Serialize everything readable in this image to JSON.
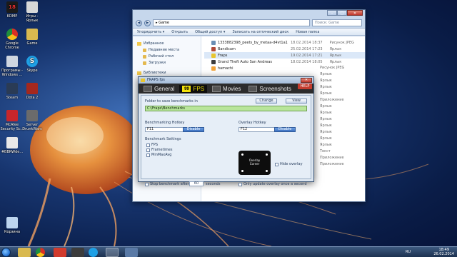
{
  "desktop": {
    "icons": [
      {
        "label": "KDMP",
        "color": "#1b1b1b",
        "badge": "18"
      },
      {
        "label": "Игры - Ярлык",
        "color": "#d8d8d8"
      },
      {
        "label": "Google Chrome",
        "color": "#e8b43a"
      },
      {
        "label": "Game",
        "color": "#d9b94f"
      },
      {
        "label": "Програмы - Windows ...",
        "color": "#cfd6e0"
      },
      {
        "label": "Skype",
        "color": "#1fa0e5"
      },
      {
        "label": "Steam",
        "color": "#2a3b55"
      },
      {
        "label": "Dota 2",
        "color": "#a4281e"
      },
      {
        "label": "McAfee Security Sc...",
        "color": "#c7262b"
      },
      {
        "label": "Server DrunkWars",
        "color": "#6b6b6b"
      },
      {
        "label": "#BBRWde...",
        "color": "#e8e8e8"
      },
      {
        "label": "Корзина",
        "color": "#bcd4ee"
      }
    ]
  },
  "explorer": {
    "address": "Game",
    "search_placeholder": "Поиск: Game",
    "toolbar": [
      "Упорядочить ▾",
      "Открыть",
      "Общий доступ ▾",
      "Записать на оптический диск",
      "Новая папка"
    ],
    "nav": {
      "favorites_label": "Избранное",
      "favorites": [
        "Недавние места",
        "Рабочий стол",
        "Загрузки"
      ],
      "libraries_label": "Библиотеки"
    },
    "files": [
      {
        "name": "1333882398_peets_by_metaa-d4vt1a1",
        "date": "18.02.2014 18:37",
        "type": "Рисунок JPEG",
        "color": "#6a8fb5"
      },
      {
        "name": "Bandicam",
        "date": "25.02.2014 17:23",
        "type": "Ярлык",
        "color": "#b04a3a"
      },
      {
        "name": "Fraps",
        "date": "19.02.2014 17:21",
        "type": "Ярлык",
        "color": "#e8c52f"
      },
      {
        "name": "Grand Theft Auto San Andreas",
        "date": "18.02.2014 18:05",
        "type": "Ярлык",
        "color": "#3d3d3d"
      },
      {
        "name": "hamachi",
        "date": "",
        "type": "",
        "color": "#f2a43a"
      }
    ],
    "more_types": [
      "Рисунок JPEG",
      "Ярлык",
      "Ярлык",
      "Ярлык",
      "Ярлык",
      "Приложение",
      "Ярлык",
      "Ярлык",
      "Ярлык",
      "Ярлык",
      "Ярлык",
      "Ярлык",
      "Ярлык",
      "Текст",
      "Приложение",
      "Приложение"
    ]
  },
  "fraps": {
    "title": "FRAPS fps",
    "tabs": [
      {
        "label": "General",
        "icon": "general-icon"
      },
      {
        "label": "FPS",
        "icon": "fps-99-icon",
        "glyph": "99"
      },
      {
        "label": "Movies",
        "icon": "movies-icon"
      },
      {
        "label": "Screenshots",
        "icon": "screenshots-icon"
      }
    ],
    "help": "HELP",
    "folder_label": "Folder to save benchmarks in",
    "change_btn": "Change",
    "view_btn": "View",
    "folder_path": "C:\\Fraps\\Benchmarks",
    "bench_hotkey_label": "Benchmarking Hotkey",
    "bench_hotkey": "F11",
    "disable_btn": "Disable",
    "overlay_hotkey_label": "Overlay Hotkey",
    "overlay_hotkey": "F12",
    "settings_label": "Benchmark Settings",
    "settings": [
      "FPS",
      "Frametimes",
      "MinMaxAvg"
    ],
    "overlay_corner": "Overlay\nCorner",
    "hide_overlay": "Hide overlay",
    "stop_after": "Stop benchmark after",
    "seconds_value": "60",
    "seconds_label": "seconds",
    "only_update": "Only update overlay once a second"
  },
  "taskbar": {
    "lang": "RU",
    "time": "18:49",
    "date": "26.02.2014"
  }
}
